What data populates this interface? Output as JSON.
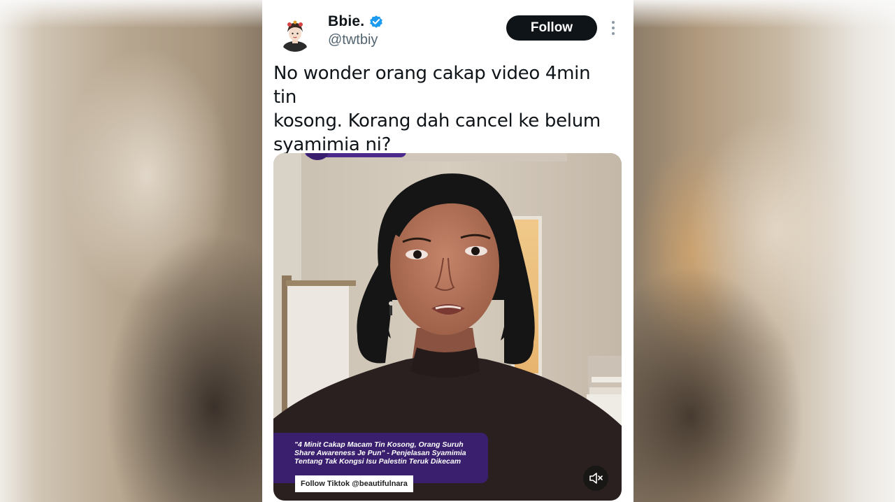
{
  "tweet": {
    "display_name": "Bbie.",
    "handle": "@twtbiy",
    "follow_label": "Follow",
    "text": "No wonder orang cakap video 4min tin\nkosong. Korang dah cancel ke belum\nsyamimia ni?"
  },
  "media": {
    "caption": "\"4 Minit Cakap Macam Tin Kosong, Orang Suruh\nShare Awareness Je Pun\" - Penjelasan Syamimia\nTentang Tak Kongsi Isu Palestin Teruk Dikecam",
    "credit": "Follow Tiktok @beautifulnara",
    "mute_icon": "speaker-muted-icon"
  },
  "icons": {
    "verified": "verified-badge-icon",
    "more": "more-options-icon"
  },
  "colors": {
    "verified_blue": "#1d9bf0",
    "follow_button": "#0f1419",
    "caption_purple": "#3a1f6e",
    "handle_grey": "#536471"
  }
}
